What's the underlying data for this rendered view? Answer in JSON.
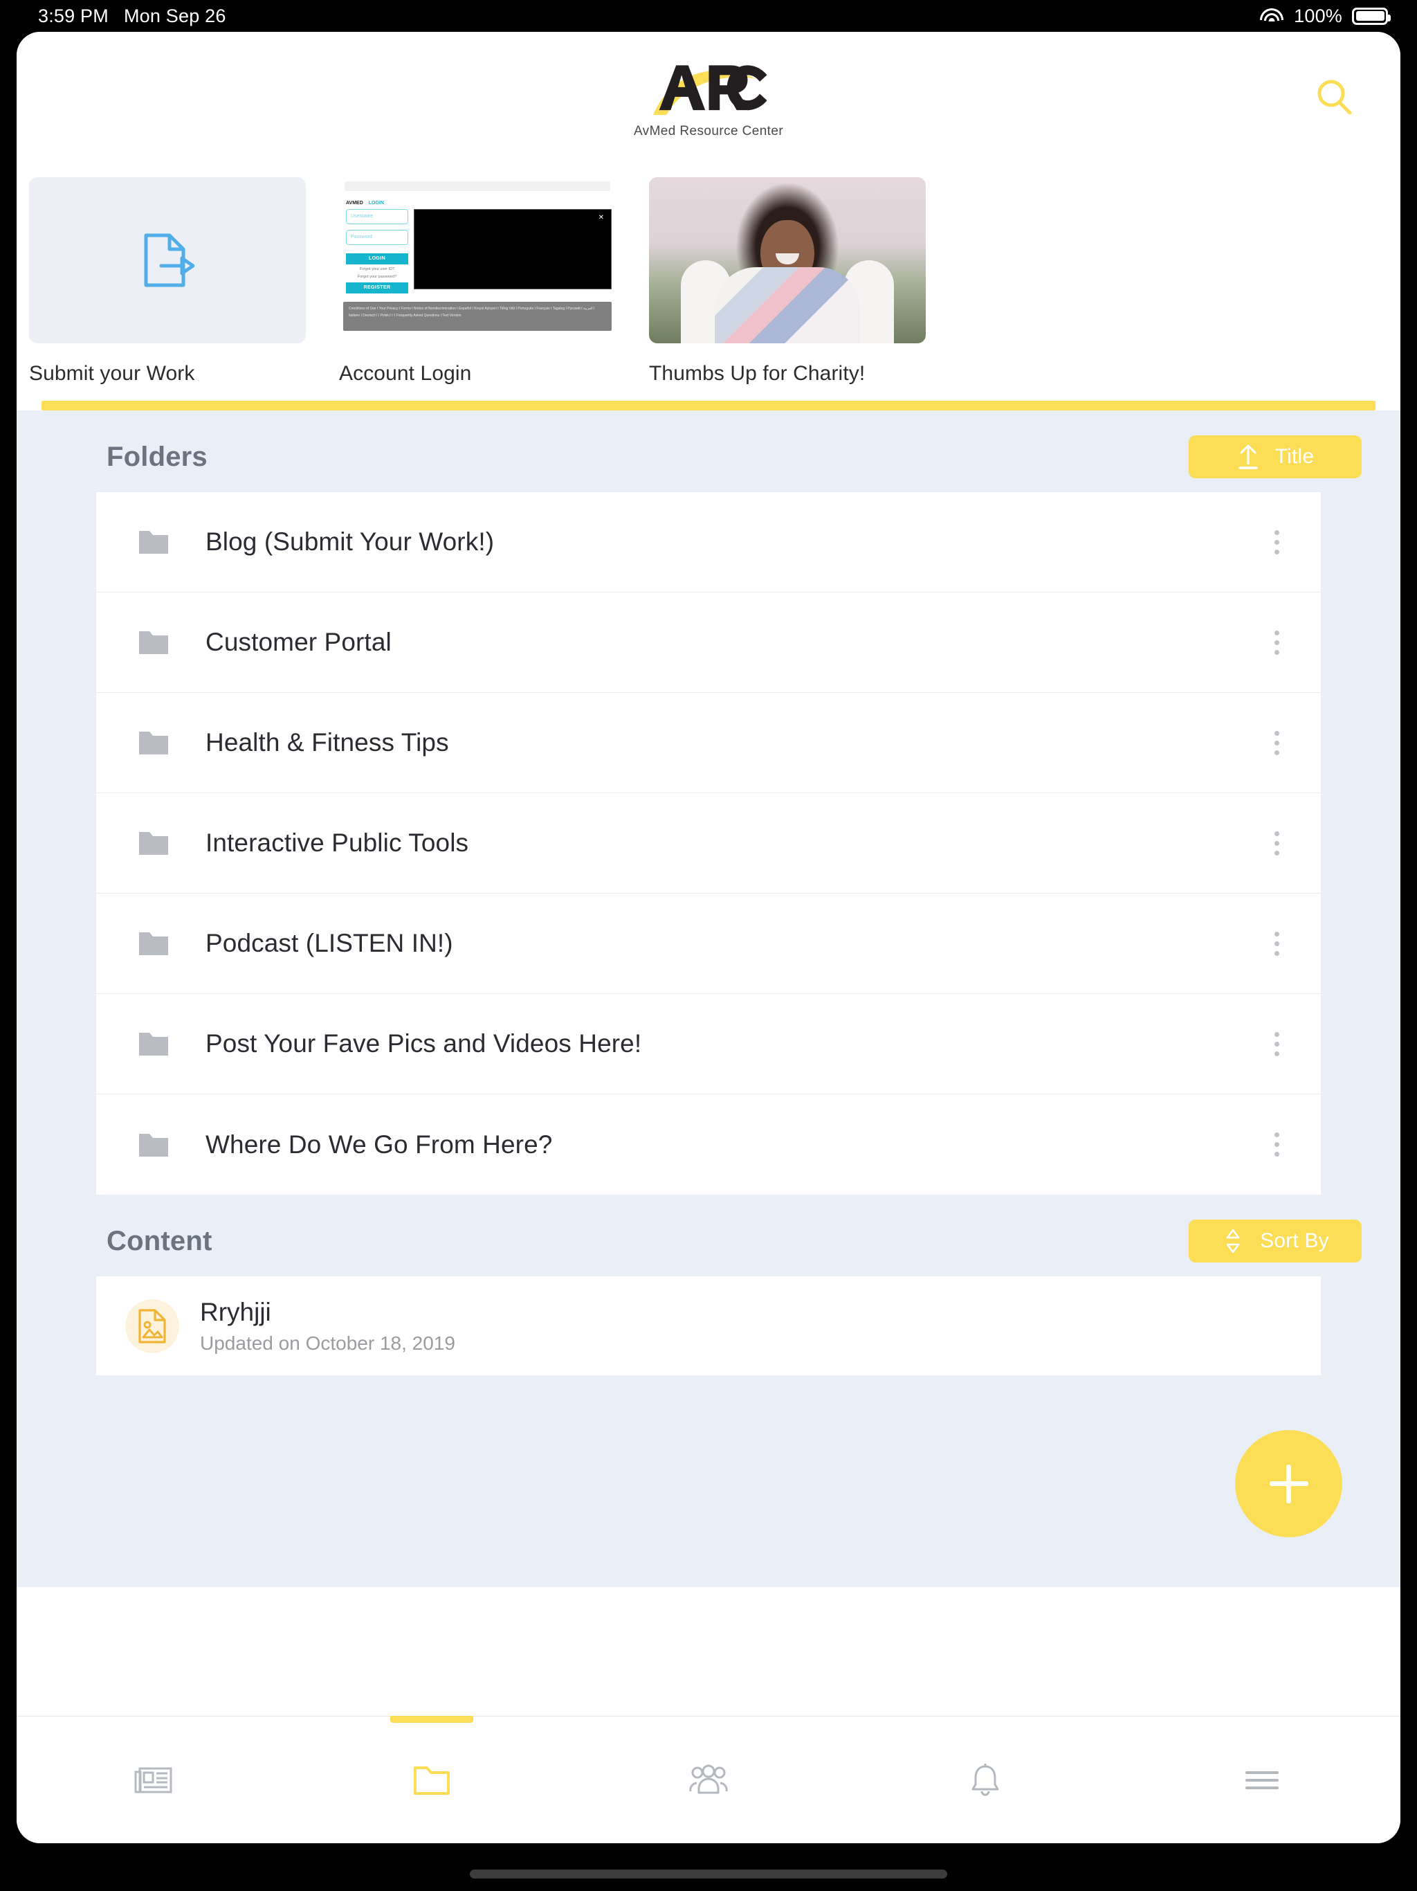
{
  "status_bar": {
    "time": "3:59 PM",
    "date": "Mon Sep 26",
    "battery_percent": "100%",
    "wifi_icon": "wifi-icon",
    "battery_icon": "battery-icon"
  },
  "header": {
    "logo_text": "ARC",
    "logo_subtitle": "AvMed Resource Center",
    "search_icon": "search-icon"
  },
  "cards": [
    {
      "label": "Submit your Work",
      "thumb_type": "icon",
      "icon": "document-export-icon",
      "icon_color": "#52aee8",
      "bg_color": "#eceff5"
    },
    {
      "label": "Account Login",
      "thumb_type": "login-screenshot",
      "mock": {
        "brand": "AVMED",
        "brand_link": "LOGIN",
        "username_placeholder": "Username",
        "password_placeholder": "Password",
        "login_button": "LOGIN",
        "register_button": "REGISTER",
        "forgot_id": "Forgot your user ID?",
        "forgot_password": "Forgot your password?",
        "modal_close": "✕",
        "footer_text": "Conditions of Use I Your Privacy I Forms I Notice of Nondiscrimination I Español I Kreyol Ayisyen I Tiếng Việt I Português I Français I Tagalog I Русский I العربية I Italiano I Deutsch I I Polski I I I Frequently Asked Questions I Text Version"
      }
    },
    {
      "label": "Thumbs Up for Charity!",
      "thumb_type": "photo"
    }
  ],
  "folders_section": {
    "title": "Folders",
    "sort_button": {
      "label": "Title",
      "icon": "sort-ascending-arrow-icon"
    },
    "items": [
      {
        "name": "Blog (Submit Your Work!)"
      },
      {
        "name": "Customer Portal"
      },
      {
        "name": "Health & Fitness Tips"
      },
      {
        "name": "Interactive Public Tools"
      },
      {
        "name": "Podcast (LISTEN IN!)"
      },
      {
        "name": "Post Your Fave Pics and Videos Here!"
      },
      {
        "name": "Where Do We Go From Here?"
      }
    ]
  },
  "content_section": {
    "title": "Content",
    "sort_button": {
      "label": "Sort By",
      "icon": "sort-updown-icon"
    },
    "items": [
      {
        "title": "Rryhjji",
        "subtitle": "Updated on October 18, 2019",
        "icon": "image-document-icon"
      }
    ]
  },
  "fab": {
    "icon": "plus-icon",
    "color": "#fbdd56"
  },
  "tab_bar": {
    "active_index": 1,
    "tabs": [
      {
        "icon": "newspaper-icon",
        "active": false
      },
      {
        "icon": "folder-icon",
        "active": true
      },
      {
        "icon": "people-icon",
        "active": false
      },
      {
        "icon": "bell-icon",
        "active": false
      },
      {
        "icon": "hamburger-menu-icon",
        "active": false
      }
    ]
  },
  "colors": {
    "accent_yellow": "#fbdd56",
    "page_bg": "#eaeff7",
    "text_dark": "#2b2c31",
    "text_muted": "#9b9ba0"
  }
}
